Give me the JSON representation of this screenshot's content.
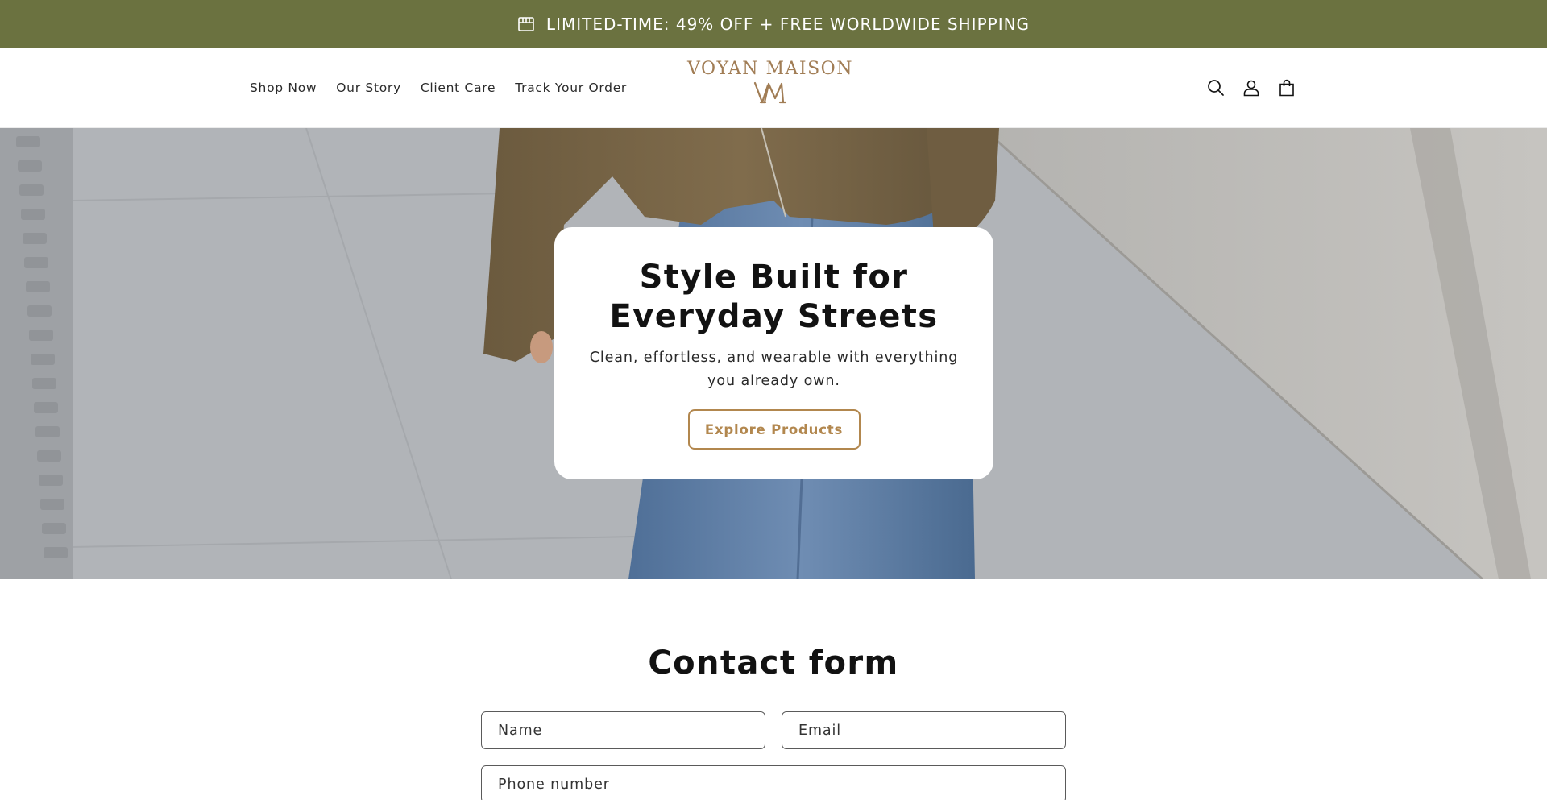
{
  "colors": {
    "announcement_bg": "#6b7240",
    "accent": "#b2874e",
    "logo": "#a17d55",
    "text": "#121212"
  },
  "announcement": {
    "icon": "store-icon",
    "text": "LIMITED-TIME: 49% OFF + FREE WORLDWIDE SHIPPING"
  },
  "header": {
    "nav": [
      {
        "label": "Shop Now"
      },
      {
        "label": "Our Story"
      },
      {
        "label": "Client Care"
      },
      {
        "label": "Track Your Order"
      }
    ],
    "logo_text": "VOYAN MAISON",
    "logo_monogram": "VM",
    "icons": [
      "search-icon",
      "account-icon",
      "cart-icon"
    ]
  },
  "hero": {
    "title": "Style Built for Everyday Streets",
    "subtitle": "Clean, effortless, and wearable with everything you already own.",
    "button_label": "Explore Products"
  },
  "contact": {
    "title": "Contact form",
    "fields": {
      "name_placeholder": "Name",
      "email_placeholder": "Email",
      "phone_placeholder": "Phone number"
    }
  }
}
